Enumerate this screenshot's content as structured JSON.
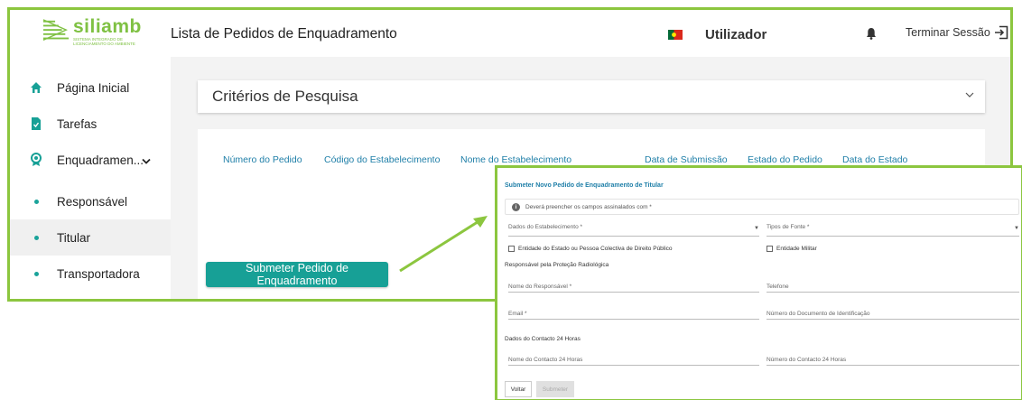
{
  "app": {
    "logo_word": "siliamb",
    "logo_sub": "Sistema Integrado de Licenciamento do Ambiente",
    "page_title": "Lista de Pedidos de Enquadramento",
    "user_label": "Utilizador",
    "logout_label": "Terminar Sessão"
  },
  "sidebar": {
    "items": [
      {
        "label": "Página Inicial",
        "icon": "home-icon"
      },
      {
        "label": "Tarefas",
        "icon": "task-icon"
      },
      {
        "label": "Enquadramen...",
        "icon": "badge-icon"
      },
      {
        "label": "Responsável",
        "icon": "dot"
      },
      {
        "label": "Titular",
        "icon": "dot"
      },
      {
        "label": "Transportadora",
        "icon": "dot"
      }
    ]
  },
  "criteria": {
    "title": "Critérios de Pesquisa"
  },
  "table": {
    "columns": [
      "Número do Pedido",
      "Código do Estabelecimento",
      "Nome do Estabelecimento",
      "Data de Submissão",
      "Estado do Pedido",
      "Data do Estado"
    ]
  },
  "submit_button": "Submeter Pedido de Enquadramento",
  "dialog": {
    "title": "Submeter Novo Pedido de Enquadramento de Titular",
    "info": "Deverá preencher os campos assinalados com *",
    "select_estabelecimento": "Dados do Estabelecimento *",
    "select_fonte": "Tipos de Fonte *",
    "check_entidade_estado": "Entidade do Estado ou Pessoa Colectiva de Direito Público",
    "check_entidade_militar": "Entidade Militar",
    "section_responsavel": "Responsável pela Proteção Radiológica",
    "field_nome_responsavel": "Nome do Responsável *",
    "field_telefone": "Telefone",
    "field_email": "Email *",
    "field_documento": "Número do Documento de Identificação",
    "section_contacto": "Dados do Contacto 24 Horas",
    "field_nome_contacto": "Nome do Contacto 24 Horas",
    "field_numero_contacto": "Número do Contacto 24 Horas",
    "btn_voltar": "Voltar",
    "btn_submeter": "Submeter"
  },
  "colors": {
    "accent": "#17a096",
    "highlight_border": "#8cc63f",
    "header_text": "#1f7fa8"
  }
}
